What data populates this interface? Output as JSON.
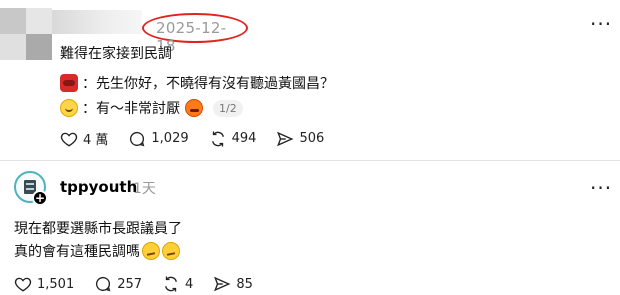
{
  "post1": {
    "date": "2025-12-18",
    "text": "難得在家接到民調",
    "dialog1": "：先生你好，不曉得有沒有聽過黃國昌？",
    "dialog2": "：有～非常討厭",
    "pager": "1/2",
    "likes": "4 萬",
    "comments": "1,029",
    "reposts": "494",
    "shares": "506"
  },
  "post2": {
    "username": "tppyouth",
    "age": "1天",
    "line1": "現在都要選縣市長跟議員了",
    "line2": "真的會有這種民調嗎",
    "likes": "1,501",
    "comments": "257",
    "reposts": "4",
    "shares": "85"
  },
  "icons": {
    "like": "heart-icon",
    "comment": "comment-icon",
    "repost": "repost-icon",
    "share": "send-icon",
    "more": "more-icon"
  },
  "colors": {
    "highlight_circle": "#e0241f",
    "date_text": "#9a9a9a",
    "age_text": "#999999"
  }
}
